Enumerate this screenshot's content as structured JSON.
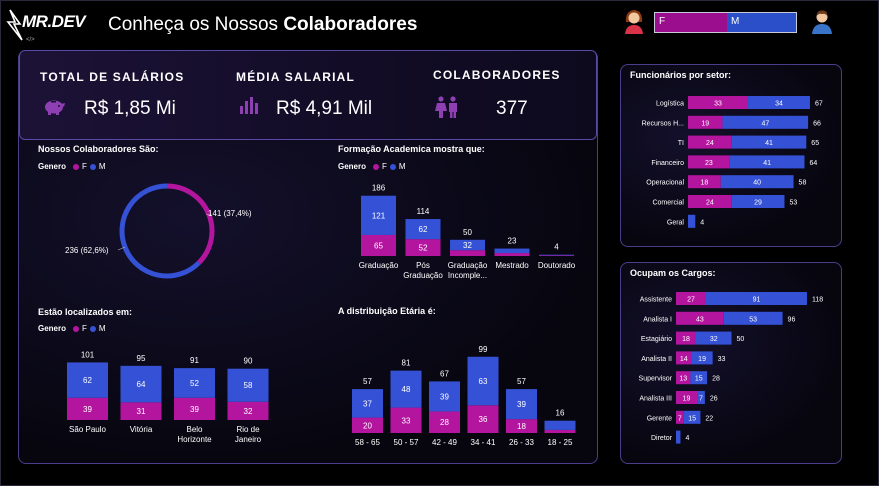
{
  "header": {
    "logo_text": "MR.DEV",
    "title_prefix": "Conheça os Nossos ",
    "title_bold": "Colaboradores",
    "slicer": {
      "f_label": "F",
      "m_label": "M"
    }
  },
  "kpis": [
    {
      "label": "TOTAL DE SALÁRIOS",
      "value": "R$ 1,85 Mi",
      "icon": "piggy-bank-icon"
    },
    {
      "label": "MÉDIA SALARIAL",
      "value": "R$ 4,91 Mil",
      "icon": "bar-chart-icon"
    },
    {
      "label": "COLABORADORES",
      "value": "377",
      "icon": "people-icon"
    }
  ],
  "legend": {
    "title": "Genero",
    "f": "F",
    "m": "M"
  },
  "colors": {
    "f": "#b4159f",
    "m": "#3552d6",
    "panel_border": "#4a3e8c"
  },
  "chart_data": [
    {
      "type": "pie",
      "title": "Nossos Colaboradores São:",
      "slices": [
        {
          "name": "F",
          "value": 141,
          "label": "141 (37,4%)"
        },
        {
          "name": "M",
          "value": 236,
          "label": "236 (62,6%)"
        }
      ]
    },
    {
      "type": "bar",
      "title": "Formação Academica mostra que:",
      "categories": [
        "Graduação",
        "Pós Graduação",
        "Graduação Incomple...",
        "Mestrado",
        "Doutorado"
      ],
      "cat_lines": [
        [
          "Graduação"
        ],
        [
          "Pós",
          "Graduação"
        ],
        [
          "Graduação",
          "Incomple..."
        ],
        [
          "Mestrado"
        ],
        [
          "Doutorado"
        ]
      ],
      "series": [
        {
          "name": "F",
          "values": [
            65,
            52,
            18,
            9,
            2
          ]
        },
        {
          "name": "M",
          "values": [
            121,
            62,
            32,
            14,
            2
          ]
        }
      ],
      "totals": [
        186,
        114,
        50,
        23,
        4
      ],
      "show_f_labels": [
        true,
        true,
        false,
        false,
        false
      ],
      "show_m_labels": [
        true,
        true,
        true,
        false,
        false
      ]
    },
    {
      "type": "bar",
      "title": "Estão localizados em:",
      "categories": [
        "São Paulo",
        "Vitória",
        "Belo Horizonte",
        "Rio de Janeiro"
      ],
      "cat_lines": [
        [
          "São Paulo"
        ],
        [
          "Vitória"
        ],
        [
          "Belo",
          "Horizonte"
        ],
        [
          "Rio de",
          "Janeiro"
        ]
      ],
      "series": [
        {
          "name": "F",
          "values": [
            39,
            31,
            39,
            32
          ]
        },
        {
          "name": "M",
          "values": [
            62,
            64,
            52,
            58
          ]
        }
      ],
      "totals": [
        101,
        95,
        91,
        90
      ]
    },
    {
      "type": "bar",
      "title": "A distribuição Etária é:",
      "categories": [
        "58 - 65",
        "50 - 57",
        "42 - 49",
        "34 - 41",
        "26 - 33",
        "18 - 25"
      ],
      "series": [
        {
          "name": "F",
          "values": [
            20,
            33,
            28,
            36,
            18,
            4
          ]
        },
        {
          "name": "M",
          "values": [
            37,
            48,
            39,
            63,
            39,
            12
          ]
        }
      ],
      "totals": [
        57,
        81,
        67,
        99,
        57,
        16
      ],
      "show_f_labels": [
        true,
        true,
        true,
        true,
        true,
        false
      ],
      "show_m_labels": [
        true,
        true,
        true,
        true,
        true,
        false
      ]
    },
    {
      "type": "bar",
      "orientation": "horizontal",
      "title": "Funcionários por setor:",
      "categories": [
        "Logística",
        "Recursos H...",
        "TI",
        "Financeiro",
        "Operacional",
        "Comercial",
        "Geral"
      ],
      "series": [
        {
          "name": "F",
          "values": [
            33,
            19,
            24,
            23,
            18,
            24,
            0
          ]
        },
        {
          "name": "M",
          "values": [
            34,
            47,
            41,
            41,
            40,
            29,
            4
          ]
        }
      ],
      "totals": [
        67,
        66,
        65,
        64,
        58,
        53,
        4
      ]
    },
    {
      "type": "bar",
      "orientation": "horizontal",
      "title": "Ocupam os Cargos:",
      "categories": [
        "Assistente",
        "Analista I",
        "Estagiário",
        "Analista II",
        "Supervisor",
        "Analista III",
        "Gerente",
        "Diretor"
      ],
      "series": [
        {
          "name": "F",
          "values": [
            27,
            43,
            18,
            14,
            13,
            19,
            7,
            0
          ]
        },
        {
          "name": "M",
          "values": [
            91,
            53,
            32,
            19,
            15,
            7,
            15,
            4
          ]
        }
      ],
      "totals": [
        118,
        96,
        50,
        33,
        28,
        26,
        22,
        4
      ]
    }
  ]
}
